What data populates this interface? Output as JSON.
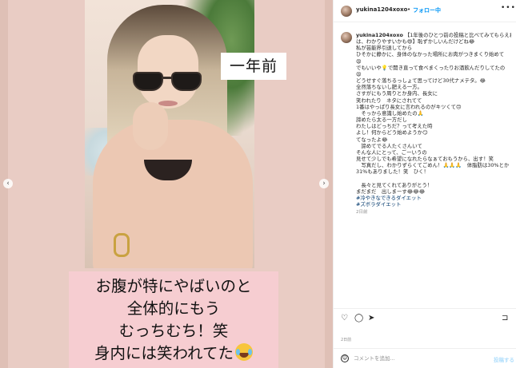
{
  "header": {
    "username": "yukina1204xoxo",
    "separator": "•",
    "follow_label": "フォロー中",
    "more_label": "•••"
  },
  "media": {
    "overlay_label": "一年前",
    "caption_lines": [
      "お腹が特にやばいのと",
      "全体的にもう",
      "むっちむち！笑",
      "身内には笑われてた"
    ],
    "prev_arrow": "‹",
    "next_arrow": "›"
  },
  "post_text": {
    "username": "yukina1204xoxo",
    "lines": [
      "【1年後のひとつ前の投稿と比べてみてもらえれ",
      "は、わかりやすいかも😄】恥ずかしいんだけどね😂",
      "私が芸能界引退してから",
      "ひそかに静かに、身体のなかった場所にお肉がつきまくり始めて",
      "😩",
      "でもいいや💡で開き直って食べまくったりお酒飲んだりしてたの",
      "😫",
      "どうせすぐ落ちるっしょて思ってけど30代ナメテタ。😂",
      "全然落ちないし肥える一方。",
      "さすがにもう周りとか身内、長女に",
      "笑われたり　ネタにされてて",
      "1番はやっぱり長女に言われるのがキツくて🙃",
      "　そっから意識し始めたの🙏",
      "諦めたら太る一方だし",
      "わたしはどっちだ？って考えた時",
      "よし！何からどう始めようか😏",
      "てなったよ😂",
      "　諦めてでる人たくさんいて",
      "そんな人にとって、ごーいうの",
      "見せて少しでも希望になれたらなぁておもうから、出す！笑",
      "　写真だし、わかりずらくてごめん！🙏🙏🙏　体脂肪は30%とか",
      "31%もありました！笑　ひく！",
      "",
      "　長々と見てくれてありがとう！",
      "まだまだ　出しまーす😂😂😂",
      "#冷やきなできるダイエット",
      "#ズボラダイエット"
    ],
    "time": "2日前"
  },
  "actions": {
    "like_icon": "♡",
    "comment_icon": "◯",
    "share_icon": "➤",
    "save_icon": "⊐",
    "date": "2日前"
  },
  "comment": {
    "emoji_icon": "☺",
    "placeholder": "コメントを追加...",
    "post_label": "投稿する"
  }
}
